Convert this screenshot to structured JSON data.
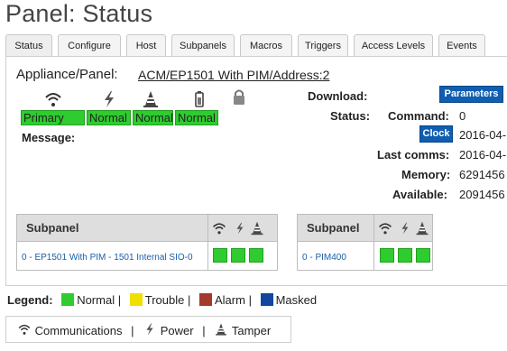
{
  "page": {
    "title": "Panel: Status"
  },
  "tabs": [
    {
      "label": "Status",
      "active": true
    },
    {
      "label": "Configure"
    },
    {
      "label": "Host"
    },
    {
      "label": "Subpanels"
    },
    {
      "label": "Macros"
    },
    {
      "label": "Triggers"
    },
    {
      "label": "Access Levels"
    },
    {
      "label": "Events"
    }
  ],
  "appliance": {
    "label": "Appliance/Panel:",
    "link": "ACM/EP1501 With PIM/Address:2"
  },
  "status_icons": [
    "wifi-icon",
    "power-icon",
    "tamper-cone-icon",
    "battery-icon",
    "lock-icon"
  ],
  "status_boxes": [
    "Primary",
    "Normal",
    "Normal",
    "Normal"
  ],
  "message": {
    "label": "Message:"
  },
  "right": {
    "download_label": "Download:",
    "parameters_button": "Parameters",
    "status_label": "Status:",
    "command_label": "Command:",
    "command_value": "0",
    "clock_button": "Clock",
    "clock_value": "2016-04-",
    "last_comms_label": "Last comms:",
    "last_comms_value": "2016-04-",
    "memory_label": "Memory:",
    "memory_value": "6291456",
    "available_label": "Available:",
    "available_value": "2091456"
  },
  "subpanel_tables": [
    {
      "header": "Subpanel",
      "row": "0 - EP1501 With PIM - 1501 Internal SIO-0",
      "indicators": [
        "Normal",
        "Normal",
        "Normal"
      ]
    },
    {
      "header": "Subpanel",
      "row": "0 - PIM400",
      "indicators": [
        "Normal",
        "Normal",
        "Normal"
      ]
    }
  ],
  "legend": {
    "label": "Legend:",
    "items": [
      {
        "label": "Normal",
        "color": "#2ecc2e"
      },
      {
        "label": "Trouble",
        "color": "#f0e000"
      },
      {
        "label": "Alarm",
        "color": "#a23a2e"
      },
      {
        "label": "Masked",
        "color": "#1246a0"
      }
    ],
    "separator": "|"
  },
  "icon_legend": {
    "communications": "Communications",
    "power": "Power",
    "tamper": "Tamper",
    "separator": "|"
  },
  "colors": {
    "normal": "#2ecc2e",
    "button_blue": "#0f5eb0"
  }
}
